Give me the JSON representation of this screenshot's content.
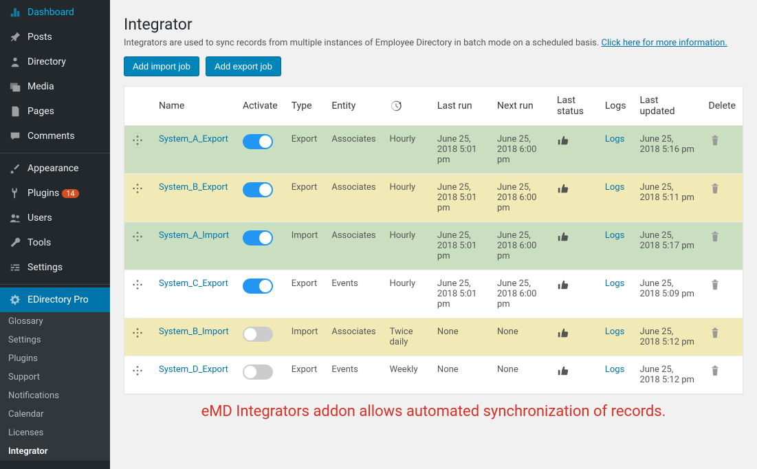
{
  "sidebar": {
    "items": [
      {
        "icon": "dashboard",
        "label": "Dashboard"
      },
      {
        "icon": "pin",
        "label": "Posts"
      },
      {
        "icon": "person",
        "label": "Directory"
      },
      {
        "icon": "media",
        "label": "Media"
      },
      {
        "icon": "page",
        "label": "Pages"
      },
      {
        "icon": "comment",
        "label": "Comments"
      },
      {
        "sep": true
      },
      {
        "icon": "brush",
        "label": "Appearance"
      },
      {
        "icon": "plug",
        "label": "Plugins",
        "badge": "14"
      },
      {
        "icon": "users",
        "label": "Users"
      },
      {
        "icon": "wrench",
        "label": "Tools"
      },
      {
        "icon": "sliders",
        "label": "Settings"
      },
      {
        "sep": true
      },
      {
        "icon": "gear",
        "label": "EDirectory Pro",
        "active": true
      }
    ],
    "sub": [
      "Glossary",
      "Settings",
      "Plugins",
      "Support",
      "Notifications",
      "Calendar",
      "Licenses",
      "Integrator"
    ],
    "sub_current": "Integrator"
  },
  "page": {
    "title": "Integrator",
    "desc_text": "Integrators are used to sync records from multiple instances of Employee Directory in batch mode on a scheduled basis. ",
    "desc_link": "Click here for more information.",
    "btn_import": "Add import job",
    "btn_export": "Add export job",
    "caption": "eMD Integrators addon allows automated synchronization of records."
  },
  "table": {
    "headers": {
      "name": "Name",
      "activate": "Activate",
      "type": "Type",
      "entity": "Entity",
      "freq": "",
      "last_run": "Last run",
      "next_run": "Next run",
      "last_status": "Last status",
      "logs": "Logs",
      "last_updated": "Last updated",
      "del": "Delete"
    },
    "rows": [
      {
        "name": "System_A_Export",
        "active": true,
        "type": "Export",
        "entity": "Associates",
        "freq": "Hourly",
        "last_run": "June 25, 2018 5:01 pm",
        "next_run": "June 25, 2018 6:00 pm",
        "logs": "Logs",
        "updated": "June 25, 2018 5:16 pm",
        "row_class": "row-green"
      },
      {
        "name": "System_B_Export",
        "active": true,
        "type": "Export",
        "entity": "Associates",
        "freq": "Hourly",
        "last_run": "June 25, 2018 5:01 pm",
        "next_run": "June 25, 2018 6:00 pm",
        "logs": "Logs",
        "updated": "June 25, 2018 5:11 pm",
        "row_class": "row-yellow"
      },
      {
        "name": "System_A_Import",
        "active": true,
        "type": "Import",
        "entity": "Associates",
        "freq": "Hourly",
        "last_run": "June 25, 2018 5:01 pm",
        "next_run": "June 25, 2018 6:00 pm",
        "logs": "Logs",
        "updated": "June 25, 2018 5:17 pm",
        "row_class": "row-green"
      },
      {
        "name": "System_C_Export",
        "active": true,
        "type": "Export",
        "entity": "Events",
        "freq": "Hourly",
        "last_run": "June 25, 2018 5:01 pm",
        "next_run": "June 25, 2018 6:00 pm",
        "logs": "Logs",
        "updated": "June 25, 2018 5:09 pm",
        "row_class": ""
      },
      {
        "name": "System_B_Import",
        "active": false,
        "type": "Import",
        "entity": "Associates",
        "freq": "Twice daily",
        "last_run": "None",
        "next_run": "None",
        "logs": "Logs",
        "updated": "June 25, 2018 5:12 pm",
        "row_class": "row-yellow"
      },
      {
        "name": "System_D_Export",
        "active": false,
        "type": "Export",
        "entity": "Events",
        "freq": "Weekly",
        "last_run": "None",
        "next_run": "None",
        "logs": "Logs",
        "updated": "June 25, 2018 5:12 pm",
        "row_class": ""
      }
    ]
  }
}
